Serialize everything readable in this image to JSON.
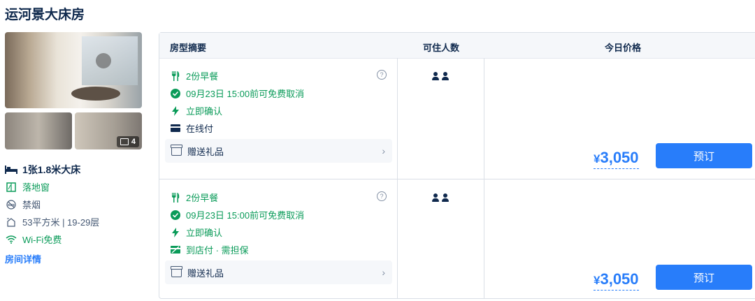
{
  "room": {
    "title": "运河景大床房",
    "photo_count": "4",
    "bed": "1张1.8米大床",
    "facts": [
      {
        "icon": "window-icon",
        "text": "落地窗",
        "green": true
      },
      {
        "icon": "no-smoking-icon",
        "text": "禁烟",
        "green": false
      },
      {
        "icon": "area-icon",
        "text": "53平方米 | 19-29层",
        "green": false
      },
      {
        "icon": "wifi-icon",
        "text": "Wi-Fi免费",
        "green": true
      }
    ],
    "details_link": "房间详情"
  },
  "table": {
    "headers": {
      "summary": "房型摘要",
      "guests": "可住人数",
      "price": "今日价格"
    },
    "offers": [
      {
        "breakfast": "2份早餐",
        "cancel": "09月23日 15:00前可免费取消",
        "confirm": "立即确认",
        "payment": "在线付",
        "gift": "赠送礼品",
        "guests": 2,
        "currency": "¥",
        "price": "3,050",
        "book": "预订"
      },
      {
        "breakfast": "2份早餐",
        "cancel": "09月23日 15:00前可免费取消",
        "confirm": "立即确认",
        "payment": "到店付 · 需担保",
        "gift": "赠送礼品",
        "guests": 2,
        "currency": "¥",
        "price": "3,050",
        "book": "预订"
      }
    ]
  },
  "colors": {
    "accent": "#287dfa",
    "green": "#0a9b59",
    "text": "#0f294d"
  }
}
